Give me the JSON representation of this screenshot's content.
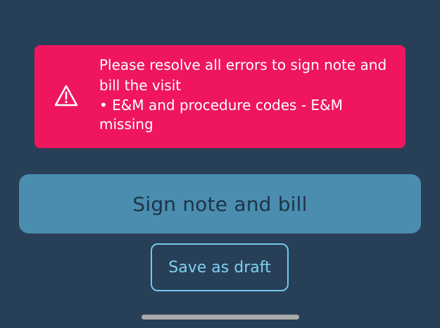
{
  "error": {
    "message": "Please resolve all errors to sign note and bill the visit",
    "bullet": "• E&M and procedure codes - E&M missing"
  },
  "actions": {
    "sign_label": "Sign note and bill",
    "draft_label": "Save as draft"
  },
  "icons": {
    "warning": "warning-triangle-icon"
  },
  "colors": {
    "background": "#283f58",
    "error": "#ef165e",
    "primary_button": "#4a8daf",
    "draft_border": "#73c8ec"
  }
}
